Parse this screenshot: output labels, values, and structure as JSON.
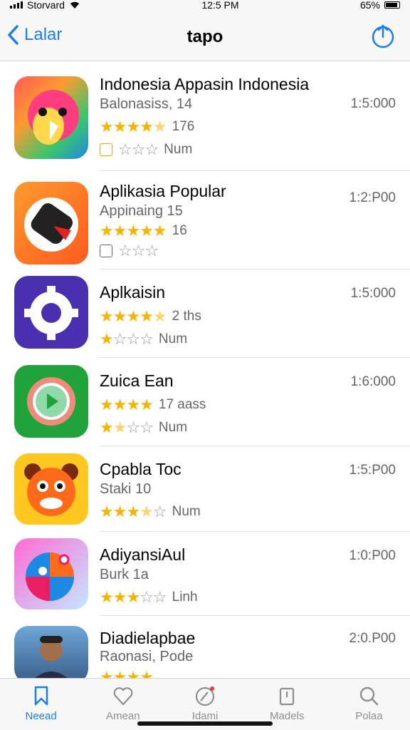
{
  "status_bar": {
    "carrier": "Storvard",
    "time": "12:5 PM",
    "battery": "65%"
  },
  "nav": {
    "back_label": "Lalar",
    "title": "tapo"
  },
  "apps": [
    {
      "name": "Indonesia Appasin Indonesia",
      "subtitle": "Balonasiss, 14",
      "time": "1:5:000",
      "rating_text": "176",
      "secondary_text": "Num",
      "stars": 4.5,
      "secondary_stars": 0
    },
    {
      "name": "Aplikasia Popular",
      "subtitle": "Appinaing 15",
      "time": "1:2:P00",
      "rating_text": "16",
      "stars": 5,
      "secondary_stars": 0
    },
    {
      "name": "Aplkaisin",
      "subtitle": "",
      "time": "1:5:000",
      "rating_text": "2 ths",
      "secondary_text": "Num",
      "stars": 4,
      "secondary_stars": 1
    },
    {
      "name": "Zuica Ean",
      "subtitle": "",
      "time": "1:6:000",
      "rating_text": "17 aass",
      "secondary_text": "Num",
      "stars": 4,
      "secondary_stars": 1.5
    },
    {
      "name": "Cpabla Toc",
      "subtitle": "Staki 10",
      "time": "1:5:P00",
      "secondary_text": "Num",
      "stars": 3.5
    },
    {
      "name": "AdiyansiAul",
      "subtitle": "Burk 1a",
      "time": "1:0:P00",
      "secondary_text": "Linh",
      "stars": 3
    },
    {
      "name": "Diadielapbae",
      "subtitle": "Raonasi, Pode",
      "time": "2:0.P00",
      "stars": 4
    }
  ],
  "tabs": [
    {
      "label": "Neead",
      "icon": "bookmark-icon",
      "active": true
    },
    {
      "label": "Amean",
      "icon": "heart-icon",
      "active": false
    },
    {
      "label": "Idami",
      "icon": "compass-icon",
      "active": false
    },
    {
      "label": "Madels",
      "icon": "clipboard-icon",
      "active": false
    },
    {
      "label": "Polaa",
      "icon": "search-icon",
      "active": false
    }
  ],
  "colors": {
    "accent": "#1a7df0",
    "star": "#f4b400"
  }
}
